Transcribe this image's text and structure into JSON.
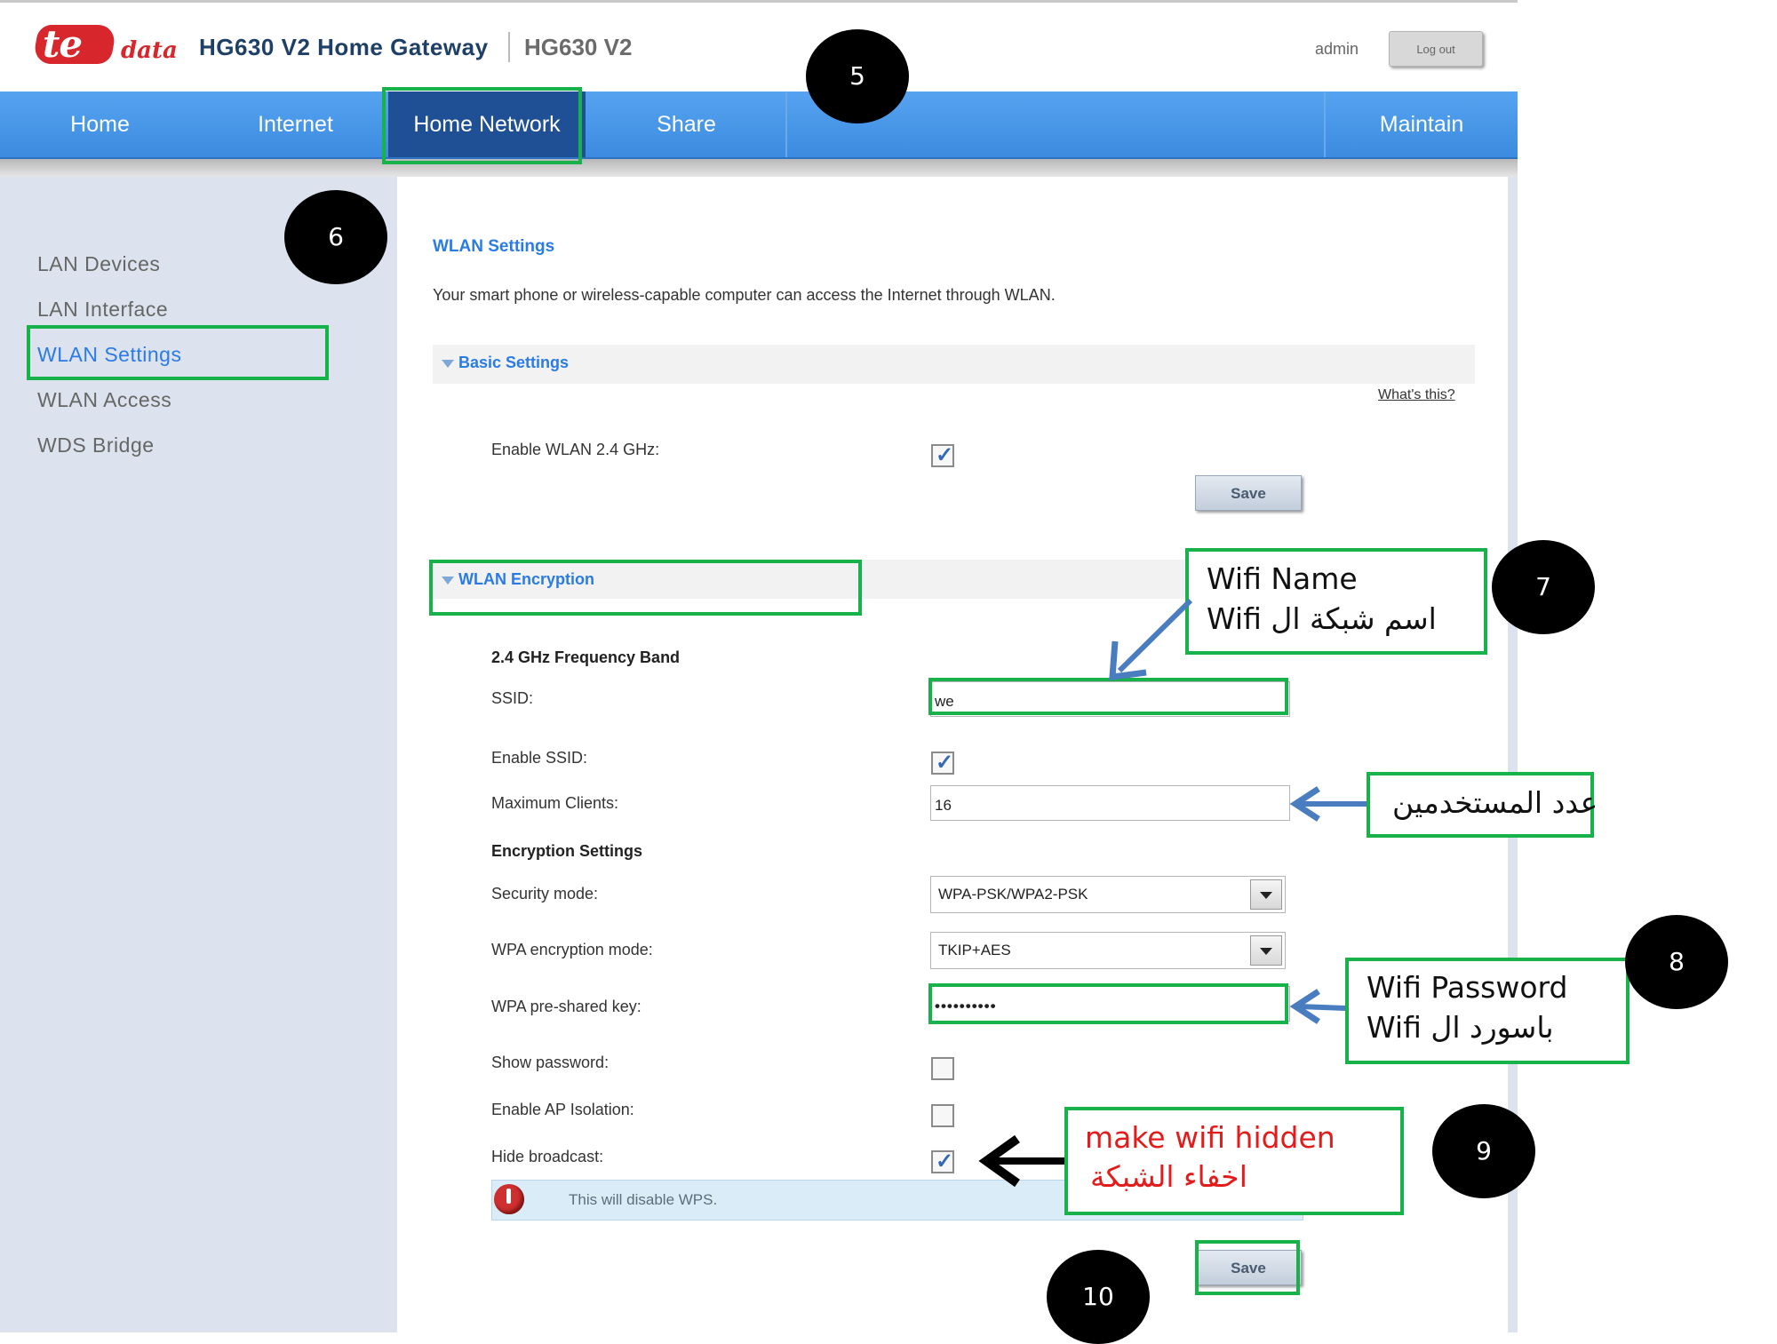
{
  "header": {
    "logo_main": "te",
    "logo_sub": "data",
    "app_title": "HG630 V2 Home Gateway",
    "model": "HG630 V2",
    "user": "admin",
    "logout_label": "Log out"
  },
  "nav": {
    "items": [
      "Home",
      "Internet",
      "Home Network",
      "Share",
      "Maintain"
    ],
    "active": "Home Network"
  },
  "sidebar": {
    "items": [
      "LAN Devices",
      "LAN Interface",
      "WLAN Settings",
      "WLAN Access",
      "WDS Bridge"
    ],
    "active": "WLAN Settings"
  },
  "main": {
    "title": "WLAN Settings",
    "description": "Your smart phone or wireless-capable computer can access the Internet through WLAN.",
    "basic": {
      "section_title": "Basic Settings",
      "help_link": "What's this?",
      "enable_wlan_label": "Enable WLAN 2.4 GHz:",
      "enable_wlan_checked": true,
      "save_label": "Save"
    },
    "encryption": {
      "section_title": "WLAN Encryption",
      "band_title": "2.4 GHz Frequency Band",
      "ssid_label": "SSID:",
      "ssid_value": "we",
      "enable_ssid_label": "Enable SSID:",
      "enable_ssid_checked": true,
      "max_clients_label": "Maximum Clients:",
      "max_clients_value": "16",
      "enc_settings_title": "Encryption Settings",
      "security_mode_label": "Security mode:",
      "security_mode_value": "WPA-PSK/WPA2-PSK",
      "wpa_enc_label": "WPA encryption mode:",
      "wpa_enc_value": "TKIP+AES",
      "psk_label": "WPA pre-shared key:",
      "psk_value": "••••••••••",
      "show_password_label": "Show password:",
      "show_password_checked": false,
      "ap_isolation_label": "Enable AP Isolation:",
      "ap_isolation_checked": false,
      "hide_broadcast_label": "Hide broadcast:",
      "hide_broadcast_checked": true,
      "warning_text": "This will disable WPS.",
      "save_label": "Save"
    }
  },
  "annotations": {
    "step_numbers": [
      "5",
      "6",
      "7",
      "8",
      "9",
      "10"
    ],
    "wifi_name": {
      "line1": "Wifi Name",
      "line2": "Wifi   اسم شبكة ال"
    },
    "max_users": {
      "text": "عدد المستخدمين"
    },
    "wifi_password": {
      "line1": "Wifi Password",
      "line2": "Wifi   باسورد ال"
    },
    "hidden": {
      "line1": "make wifi hidden",
      "line2": "اخفاء الشبكة"
    },
    "colors": {
      "highlight": "#17b24a",
      "arrow": "#4a7cc0",
      "hidden_text": "#e31b1b"
    }
  }
}
